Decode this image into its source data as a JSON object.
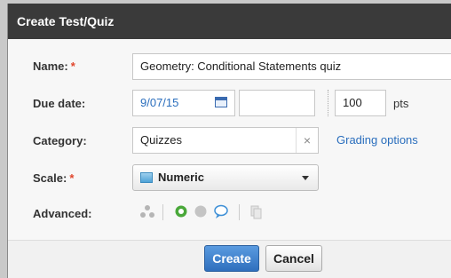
{
  "dialog": {
    "title": "Create Test/Quiz"
  },
  "form": {
    "name_label": "Name:",
    "name_required": "*",
    "name_value": "Geometry: Conditional Statements quiz",
    "due_label": "Due date:",
    "due_value": "9/07/15",
    "time_value": "",
    "points_value": "100",
    "points_unit": "pts",
    "category_label": "Category:",
    "category_value": "Quizzes",
    "category_clear": "×",
    "grading_options": "Grading options",
    "scale_label": "Scale:",
    "scale_required": "*",
    "scale_value": "Numeric",
    "advanced_label": "Advanced:"
  },
  "buttons": {
    "create": "Create",
    "cancel": "Cancel"
  },
  "icons": [
    "calendar-icon",
    "clear-icon",
    "numeric-scale-icon",
    "chevron-down-icon",
    "individual-assign-icon",
    "publish-status-icon",
    "grades-hidden-icon",
    "comments-icon",
    "copy-icon"
  ]
}
